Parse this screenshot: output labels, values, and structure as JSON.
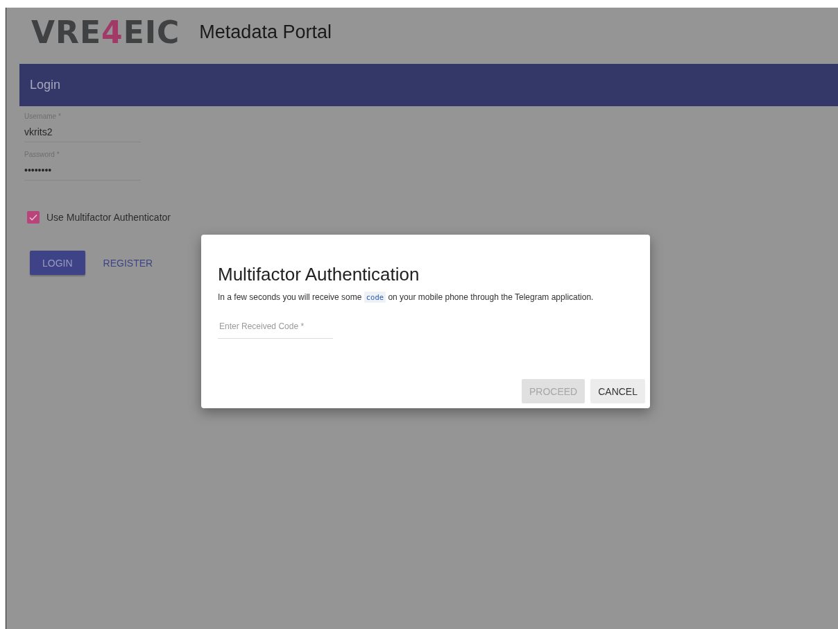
{
  "logo": {
    "parts": [
      {
        "text": "VRE",
        "accent": false
      },
      {
        "text": "4",
        "accent": true
      },
      {
        "text": "EIC",
        "accent": false
      }
    ]
  },
  "site_title": "Metadata Portal",
  "login": {
    "title": "Login",
    "fields": [
      {
        "label": "Username *",
        "value": "vkrits2"
      },
      {
        "label": "Password *",
        "value": "••••••••"
      }
    ],
    "mfa_checkbox": {
      "label": "Use Multifactor Authenticator",
      "checked": true
    },
    "buttons": [
      {
        "label": "LOGIN",
        "kind": "primary"
      },
      {
        "label": "REGISTER",
        "kind": "text"
      }
    ]
  },
  "dialog": {
    "title": "Multifactor Authentication",
    "description": [
      {
        "kind": "text",
        "text": "In a few seconds you will receive some"
      },
      {
        "kind": "code",
        "text": "code"
      },
      {
        "kind": "text",
        "text": "on your mobile phone through the Telegram application."
      }
    ],
    "code_field": {
      "placeholder": "Enter Received Code *"
    },
    "buttons": [
      {
        "label": "PROCEED",
        "disabled": true
      },
      {
        "label": "CANCEL",
        "disabled": false
      }
    ]
  }
}
